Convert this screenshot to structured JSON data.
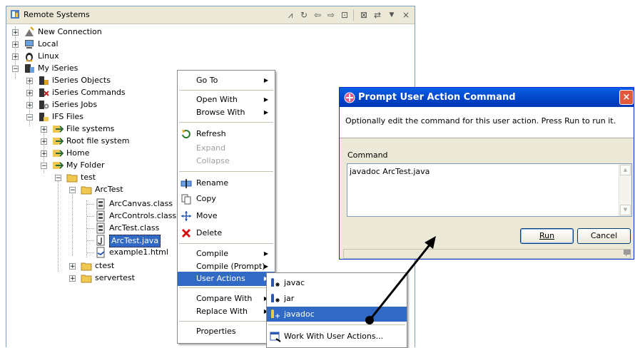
{
  "view": {
    "title": "Remote Systems",
    "toolbar_icons": [
      "remote-systems-icon",
      "refresh-icon",
      "back-arrow-icon",
      "forward-arrow-icon",
      "up-level-icon",
      "collapse-all-icon",
      "link-icon",
      "view-menu-icon",
      "close-icon"
    ]
  },
  "tree": {
    "new_connection": "New Connection",
    "local": "Local",
    "linux": "Linux",
    "my_iseries": "My iSeries",
    "iseries_objects": "iSeries Objects",
    "iseries_commands": "iSeries Commands",
    "iseries_jobs": "iSeries Jobs",
    "ifs_files": "IFS Files",
    "file_systems": "File systems",
    "root_file_system": "Root file system",
    "home": "Home",
    "my_folder": "My Folder",
    "test": "test",
    "arctest": "ArcTest",
    "arccanvas": "ArcCanvas.class",
    "arccontrols": "ArcControls.class",
    "arctest_class": "ArcTest.class",
    "arctest_java": "ArcTest.java",
    "example1": "example1.html",
    "ctest": "ctest",
    "servertest": "servertest"
  },
  "context_menu": {
    "go_to": "Go To",
    "open_with": "Open With",
    "browse_with": "Browse With",
    "refresh": "Refresh",
    "expand": "Expand",
    "collapse": "Collapse",
    "rename": "Rename",
    "copy": "Copy",
    "move": "Move",
    "delete": "Delete",
    "compile": "Compile",
    "compile_prompt": "Compile (Prompt)",
    "user_actions": "User Actions",
    "compare_with": "Compare With",
    "replace_with": "Replace With",
    "properties": "Properties"
  },
  "submenu": {
    "javac": "javac",
    "jar": "jar",
    "javadoc": "javadoc",
    "work_with": "Work With User Actions..."
  },
  "dialog": {
    "title": "Prompt User Action Command",
    "message": "Optionally edit the command for this user action. Press Run to run it.",
    "command_label": "Command",
    "command_value": "javadoc ArcTest.java",
    "run_label": "Run",
    "cancel_label": "Cancel",
    "close_glyph": "×"
  },
  "colors": {
    "selection": "#316ac5",
    "title_bar": "#0043c6",
    "close_button": "#e05a3a",
    "folder": "#f0c850"
  }
}
